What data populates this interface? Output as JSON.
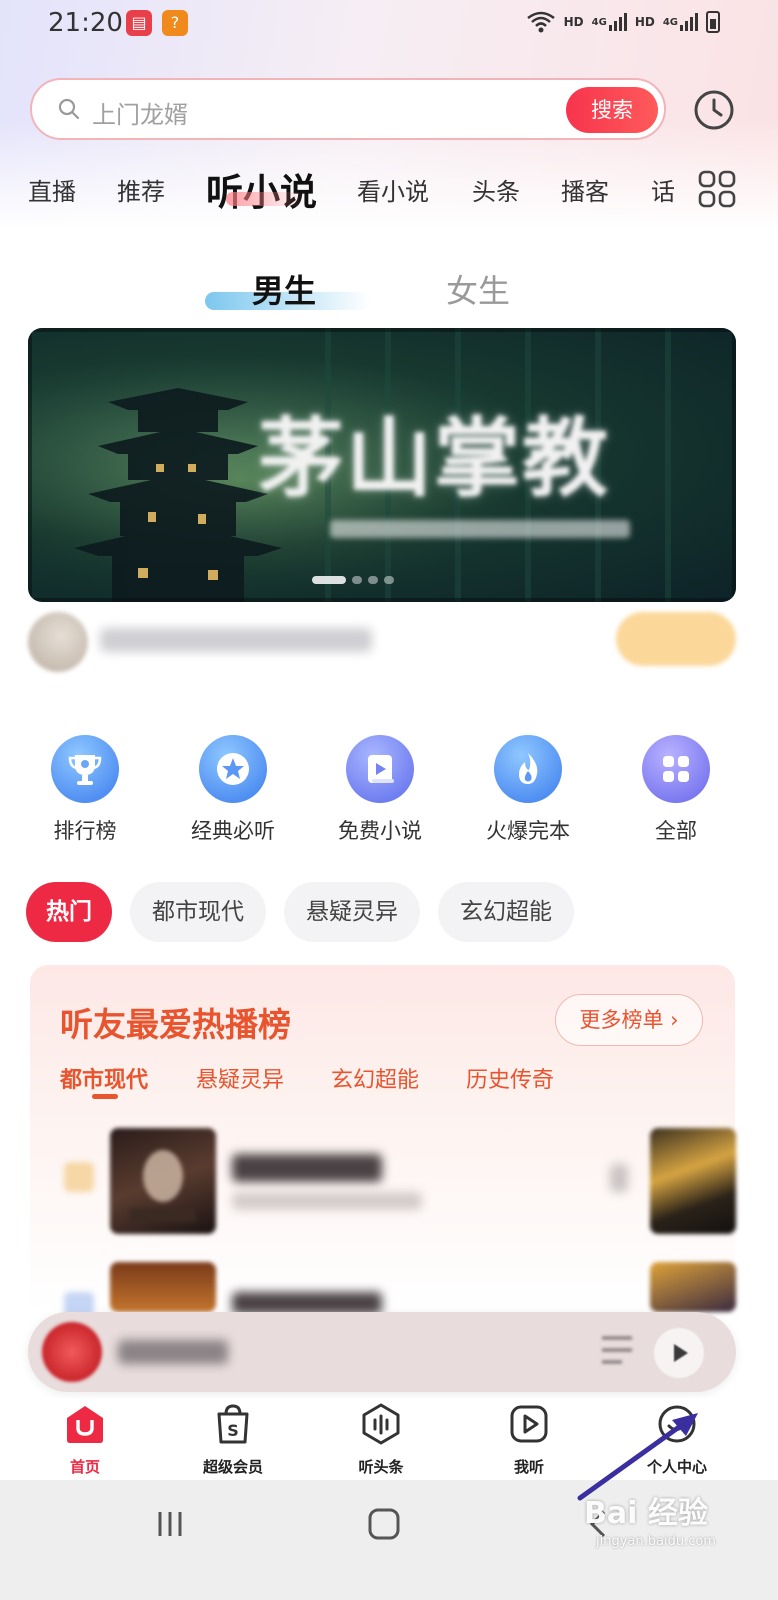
{
  "status_bar": {
    "time": "21:20",
    "network_labels": [
      "HD",
      "4G",
      "HD",
      "4G"
    ]
  },
  "search": {
    "placeholder": "上门龙婿",
    "button_label": "搜索"
  },
  "nav_tabs": [
    {
      "label": "直播",
      "active": false
    },
    {
      "label": "推荐",
      "active": false
    },
    {
      "label": "听小说",
      "active": true
    },
    {
      "label": "看小说",
      "active": false
    },
    {
      "label": "头条",
      "active": false
    },
    {
      "label": "播客",
      "active": false
    },
    {
      "label": "话",
      "active": false
    }
  ],
  "gender_tabs": {
    "male": "男生",
    "female": "女生",
    "selected": "男生"
  },
  "banner": {
    "title": "茅山掌教"
  },
  "categories": [
    {
      "label": "排行榜",
      "icon": "trophy-icon"
    },
    {
      "label": "经典必听",
      "icon": "star-icon"
    },
    {
      "label": "免费小说",
      "icon": "book-play-icon"
    },
    {
      "label": "火爆完本",
      "icon": "flame-icon"
    },
    {
      "label": "全部",
      "icon": "grid-icon"
    }
  ],
  "chips": [
    {
      "label": "热门",
      "active": true
    },
    {
      "label": "都市现代",
      "active": false
    },
    {
      "label": "悬疑灵异",
      "active": false
    },
    {
      "label": "玄幻超能",
      "active": false
    }
  ],
  "ranking": {
    "title": "听友最爱热播榜",
    "more_label": "更多榜单 ›",
    "subtabs": [
      {
        "label": "都市现代",
        "active": true
      },
      {
        "label": "悬疑灵异",
        "active": false
      },
      {
        "label": "玄幻超能",
        "active": false
      },
      {
        "label": "历史传奇",
        "active": false
      }
    ]
  },
  "bottom_nav": [
    {
      "label": "首页",
      "icon": "home-icon",
      "active": true
    },
    {
      "label": "超级会员",
      "icon": "vip-bag-icon",
      "active": false
    },
    {
      "label": "听头条",
      "icon": "audio-news-icon",
      "active": false
    },
    {
      "label": "我听",
      "icon": "play-square-icon",
      "active": false
    },
    {
      "label": "个人中心",
      "icon": "profile-icon",
      "active": false
    }
  ],
  "watermark": {
    "text": "Bai 经验",
    "url": "jingyan.baidu.com"
  },
  "colors": {
    "accent_red": "#ee2944",
    "ranking_orange": "#e8542e",
    "category_blue": "#4f8ef2",
    "annotation_arrow": "#3b2fa0"
  }
}
